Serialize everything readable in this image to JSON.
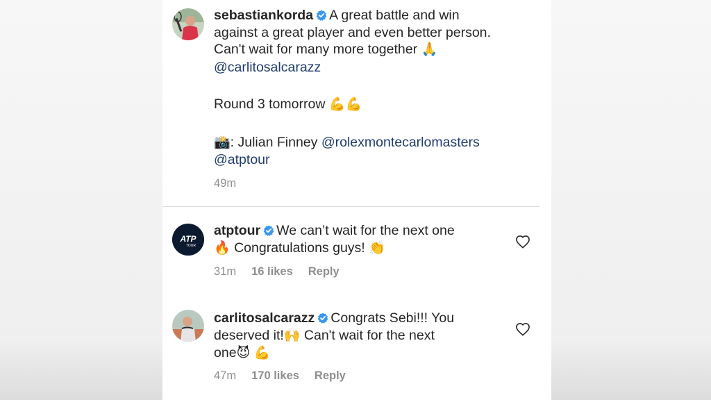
{
  "post": {
    "username": "sebastiankorda",
    "line1": "A great battle and win",
    "line2": "against a great player and even better person.",
    "line3": "Can't wait for many more together",
    "emoji_pray": "🙏",
    "mention1": "@carlitosalcarazz",
    "round_text": "Round 3 tomorrow",
    "emoji_muscle2": "💪💪",
    "emoji_camera": "📸",
    "photo_credit": ": Julian Finney",
    "mention2": "@rolexmontecarlomasters",
    "mention3": "@atptour",
    "time": "49m"
  },
  "comments": [
    {
      "username": "atptour",
      "line1": "We can’t wait for the next one",
      "emoji_fire": "🔥",
      "line2": "Congratulations guys!",
      "emoji_clap": "👏",
      "time": "31m",
      "likes": "16 likes",
      "reply": "Reply",
      "avatar_logo": "ATP",
      "avatar_sub": "TOUR"
    },
    {
      "username": "carlitosalcarazz",
      "line1": "Congrats Sebi!!! You",
      "line2a": "deserved it!",
      "emoji_raise": "🙌",
      "line2b": "Can't wait for the next",
      "line3": "one",
      "emoji_devil": "😈",
      "emoji_muscle": "💪",
      "time": "47m",
      "likes": "170 likes",
      "reply": "Reply"
    }
  ],
  "colors": {
    "verified": "#3897f0",
    "mention": "#1e3c6e",
    "meta": "#8e8e8e"
  }
}
